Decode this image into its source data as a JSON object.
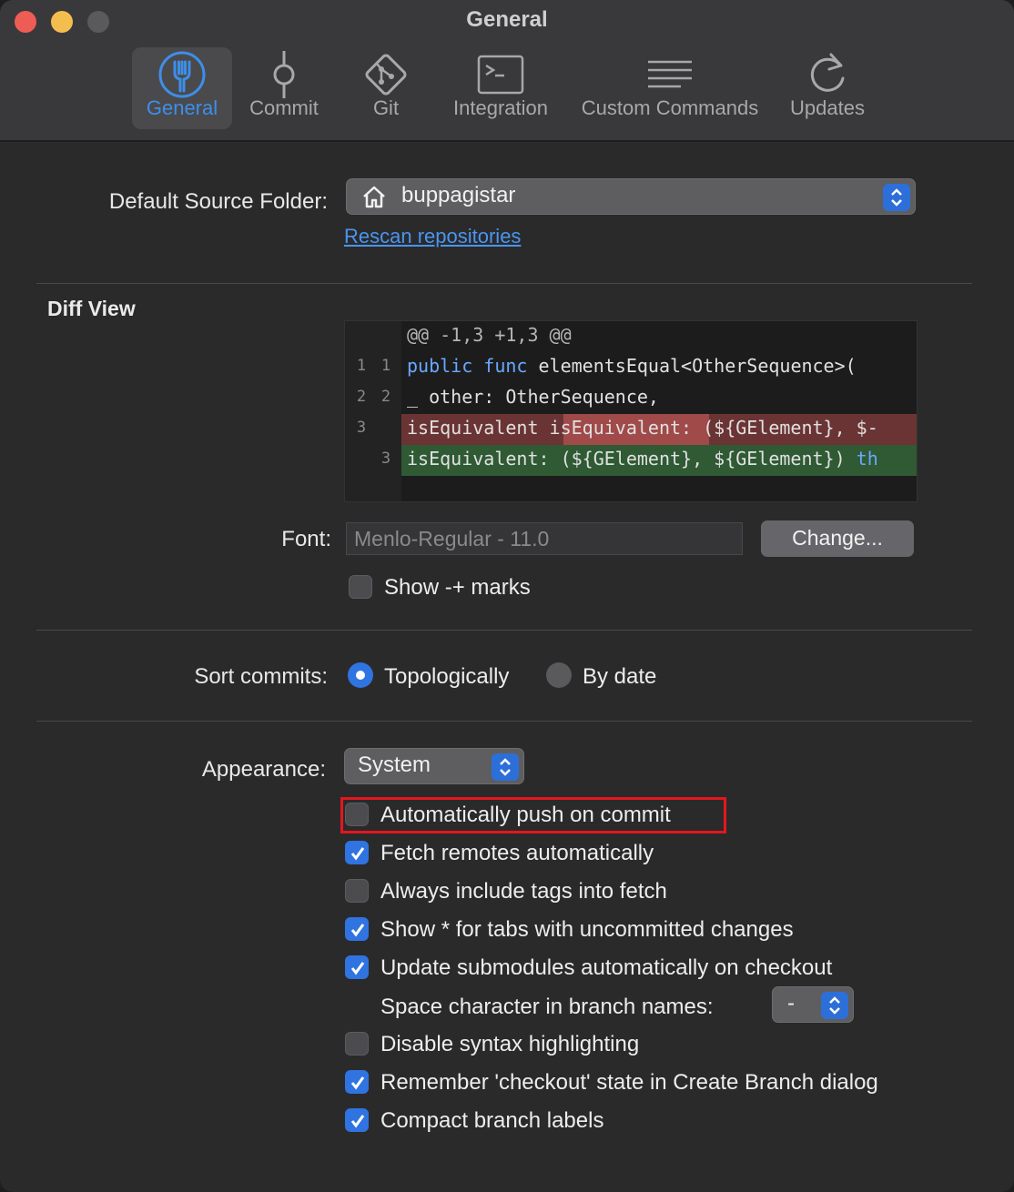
{
  "window": {
    "title": "General"
  },
  "toolbar": {
    "tabs": [
      {
        "label": "General",
        "icon": "fork-icon",
        "active": true
      },
      {
        "label": "Commit",
        "icon": "commit-icon"
      },
      {
        "label": "Git",
        "icon": "git-icon"
      },
      {
        "label": "Integration",
        "icon": "terminal-icon"
      },
      {
        "label": "Custom Commands",
        "icon": "lines-icon"
      },
      {
        "label": "Updates",
        "icon": "refresh-icon"
      }
    ]
  },
  "source_folder": {
    "label": "Default Source Folder:",
    "value": "buppagistar",
    "icon": "home-icon",
    "rescan_link": "Rescan repositories"
  },
  "diff_view": {
    "title": "Diff View",
    "lines": [
      {
        "old": "",
        "new": "",
        "text": "@@ -1,3 +1,3 @@",
        "type": "hunk"
      },
      {
        "old": "1",
        "new": "1",
        "text_kw": "public func",
        "text": " elementsEqual<OtherSequence>(",
        "type": "context"
      },
      {
        "old": "2",
        "new": "2",
        "text": "_ other: OtherSequence,",
        "type": "context"
      },
      {
        "old": "3",
        "new": "",
        "text": "isEquivalent isEquivalent: (${GElement}, $-",
        "type": "deleted"
      },
      {
        "old": "",
        "new": "3",
        "text": "isEquivalent: (${GElement}, ${GElement}) ",
        "text_kw": "th",
        "type": "added"
      }
    ],
    "font_label": "Font:",
    "font_value": "Menlo-Regular - 11.0",
    "change_button": "Change...",
    "show_marks_label": "Show -+ marks",
    "show_marks_checked": false
  },
  "sort_commits": {
    "label": "Sort commits:",
    "options": [
      "Topologically",
      "By date"
    ],
    "selected": "Topologically"
  },
  "appearance": {
    "label": "Appearance:",
    "value": "System"
  },
  "options": [
    {
      "label": "Automatically push on commit",
      "checked": false
    },
    {
      "label": "Fetch remotes automatically",
      "checked": true
    },
    {
      "label": "Always include tags into fetch",
      "checked": false
    },
    {
      "label": "Show * for tabs with uncommitted changes",
      "checked": true
    },
    {
      "label": "Update submodules automatically on checkout",
      "checked": true
    }
  ],
  "space_char": {
    "label": "Space character in branch names:",
    "value": "-"
  },
  "options_more": [
    {
      "label": "Disable syntax highlighting",
      "checked": false
    },
    {
      "label": "Remember 'checkout' state in Create Branch dialog",
      "checked": true
    },
    {
      "label": "Compact branch labels",
      "checked": true
    }
  ],
  "colors": {
    "accent": "#2f74e0",
    "highlight_box": "#e4161d",
    "diff_deleted": "#6b3434",
    "diff_added": "#2f5a34"
  }
}
